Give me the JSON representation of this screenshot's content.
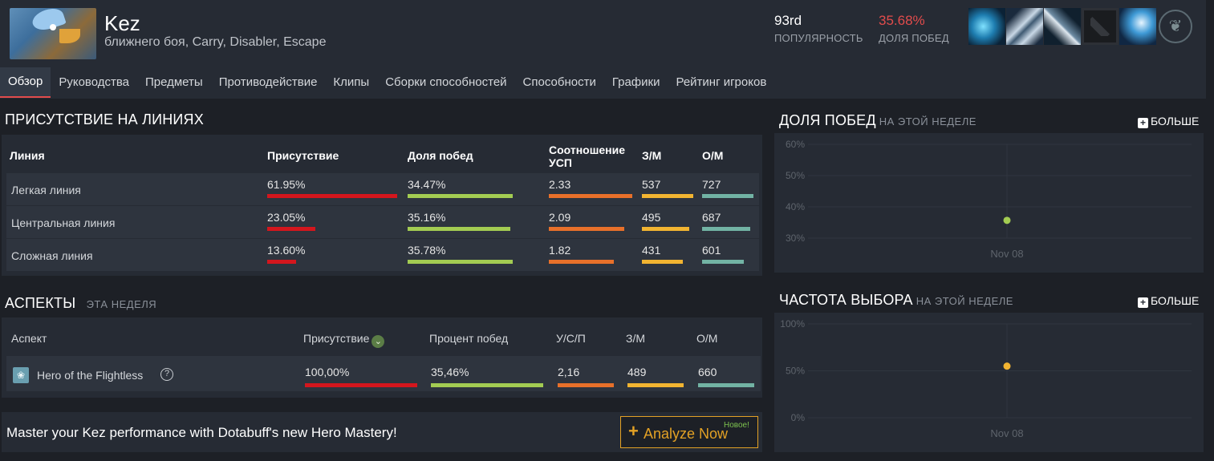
{
  "hero": {
    "name": "Kez",
    "roles": "ближнего боя, Carry, Disabler, Escape",
    "rank_value": "93rd",
    "rank_label": "ПОПУЛЯРНОСТЬ",
    "winrate_value": "35.68%",
    "winrate_label": "ДОЛЯ ПОБЕД",
    "recent_items": [
      "item-1-icon",
      "item-2-icon",
      "item-3-icon",
      "dota-logo-icon",
      "item-5-icon",
      "facet-leaf-icon"
    ]
  },
  "tabs": [
    {
      "label": "Обзор",
      "active": true
    },
    {
      "label": "Руководства"
    },
    {
      "label": "Предметы"
    },
    {
      "label": "Противодействие"
    },
    {
      "label": "Клипы"
    },
    {
      "label": "Сборки способностей"
    },
    {
      "label": "Способности"
    },
    {
      "label": "Графики"
    },
    {
      "label": "Рейтинг игроков"
    }
  ],
  "lanes": {
    "title": "ПРИСУТСТВИЕ НА ЛИНИЯХ",
    "headers": {
      "lane": "Линия",
      "presence": "Присутствие",
      "winrate": "Доля побед",
      "kda": "Соотношение УСП",
      "gpm": "З/М",
      "xpm": "О/М"
    },
    "rows": [
      {
        "name": "Легкая линия",
        "presence": "61.95%",
        "winrate": "34.47%",
        "kda": "2.33",
        "gpm": "537",
        "xpm": "727",
        "fill": {
          "presence": 1.0,
          "winrate": 1.0,
          "kda": 1.0,
          "gpm": 1.0,
          "xpm": 1.0
        }
      },
      {
        "name": "Центральная линия",
        "presence": "23.05%",
        "winrate": "35.16%",
        "kda": "2.09",
        "gpm": "495",
        "xpm": "687",
        "fill": {
          "presence": 0.37,
          "winrate": 0.98,
          "kda": 0.9,
          "gpm": 0.92,
          "xpm": 0.94
        }
      },
      {
        "name": "Сложная линия",
        "presence": "13.60%",
        "winrate": "35.78%",
        "kda": "1.82",
        "gpm": "431",
        "xpm": "601",
        "fill": {
          "presence": 0.22,
          "winrate": 1.0,
          "kda": 0.78,
          "gpm": 0.8,
          "xpm": 0.82
        }
      }
    ]
  },
  "aspects": {
    "title": "АСПЕКТЫ",
    "subtitle": "ЭТА НЕДЕЛЯ",
    "headers": {
      "aspect": "Аспект",
      "presence": "Присутствие",
      "winrate": "Процент побед",
      "kda": "У/С/П",
      "gpm": "З/М",
      "xpm": "О/М"
    },
    "rows": [
      {
        "name": "Hero of the Flightless",
        "presence": "100,00%",
        "winrate": "35,46%",
        "kda": "2,16",
        "gpm": "489",
        "xpm": "660",
        "fill": {
          "presence": 1.0,
          "winrate": 1.0,
          "kda": 1.0,
          "gpm": 1.0,
          "xpm": 1.0
        }
      }
    ]
  },
  "promo": {
    "text": "Master your Kez performance with Dotabuff's new Hero Mastery!",
    "button_label": "Analyze Now",
    "new_badge": "Новое!"
  },
  "more_label": "БОЛЬШЕ",
  "colors": {
    "presence": "#d4161d",
    "winrate": "#a3cc52",
    "kda": "#e8702a",
    "gpm": "#f2b431",
    "xpm": "#72b3a4"
  },
  "chart_data": [
    {
      "type": "scatter",
      "title": "ДОЛЯ ПОБЕД",
      "subtitle": "НА ЭТОЙ НЕДЕЛЕ",
      "categories": [
        "Nov 08"
      ],
      "values": [
        35.68
      ],
      "yticks": [
        "60%",
        "50%",
        "40%",
        "30%"
      ],
      "ylim": [
        30,
        60
      ],
      "color": "#a3cc52",
      "grid": true
    },
    {
      "type": "scatter",
      "title": "ЧАСТОТА ВЫБОРА",
      "subtitle": "НА ЭТОЙ НЕДЕЛЕ",
      "categories": [
        "Nov 08"
      ],
      "values": [
        55
      ],
      "yticks": [
        "100%",
        "50%",
        "0%"
      ],
      "ylim": [
        0,
        100
      ],
      "color": "#f2b431",
      "grid": true
    }
  ]
}
